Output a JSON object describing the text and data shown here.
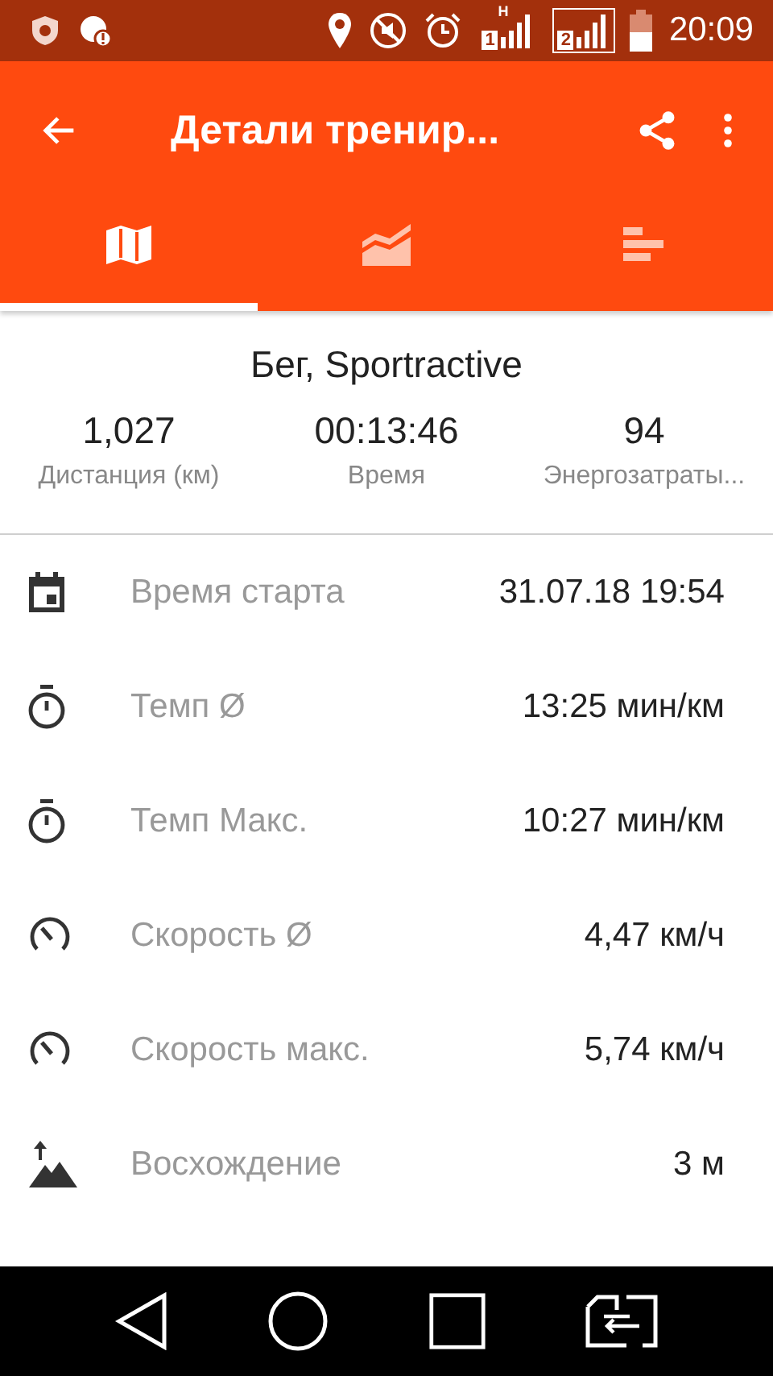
{
  "status_bar": {
    "time": "20:09",
    "sims": [
      {
        "label": "1",
        "network": "H"
      },
      {
        "label": "2"
      }
    ]
  },
  "app_bar": {
    "title": "Детали тренир..."
  },
  "tabs": [
    {
      "kind": "map",
      "selected": true
    },
    {
      "kind": "graph",
      "selected": false
    },
    {
      "kind": "bars",
      "selected": false
    }
  ],
  "summary": {
    "title": "Бег, Sportractive",
    "stats": [
      {
        "value": "1,027",
        "label": "Дистанция (км)"
      },
      {
        "value": "00:13:46",
        "label": "Время"
      },
      {
        "value": "94",
        "label": "Энергозатраты..."
      }
    ]
  },
  "rows": [
    {
      "kind": "calendar",
      "label": "Время старта",
      "value": "31.07.18 19:54"
    },
    {
      "kind": "stopwatch",
      "label": "Темп Ø",
      "value": "13:25 мин/км"
    },
    {
      "kind": "stopwatch",
      "label": "Темп Макс.",
      "value": "10:27 мин/км"
    },
    {
      "kind": "speedometer",
      "label": "Скорость Ø",
      "value": "4,47 км/ч"
    },
    {
      "kind": "speedometer",
      "label": "Скорость макс.",
      "value": "5,74 км/ч"
    },
    {
      "kind": "ascent",
      "label": "Восхождение",
      "value": "3 м"
    }
  ]
}
